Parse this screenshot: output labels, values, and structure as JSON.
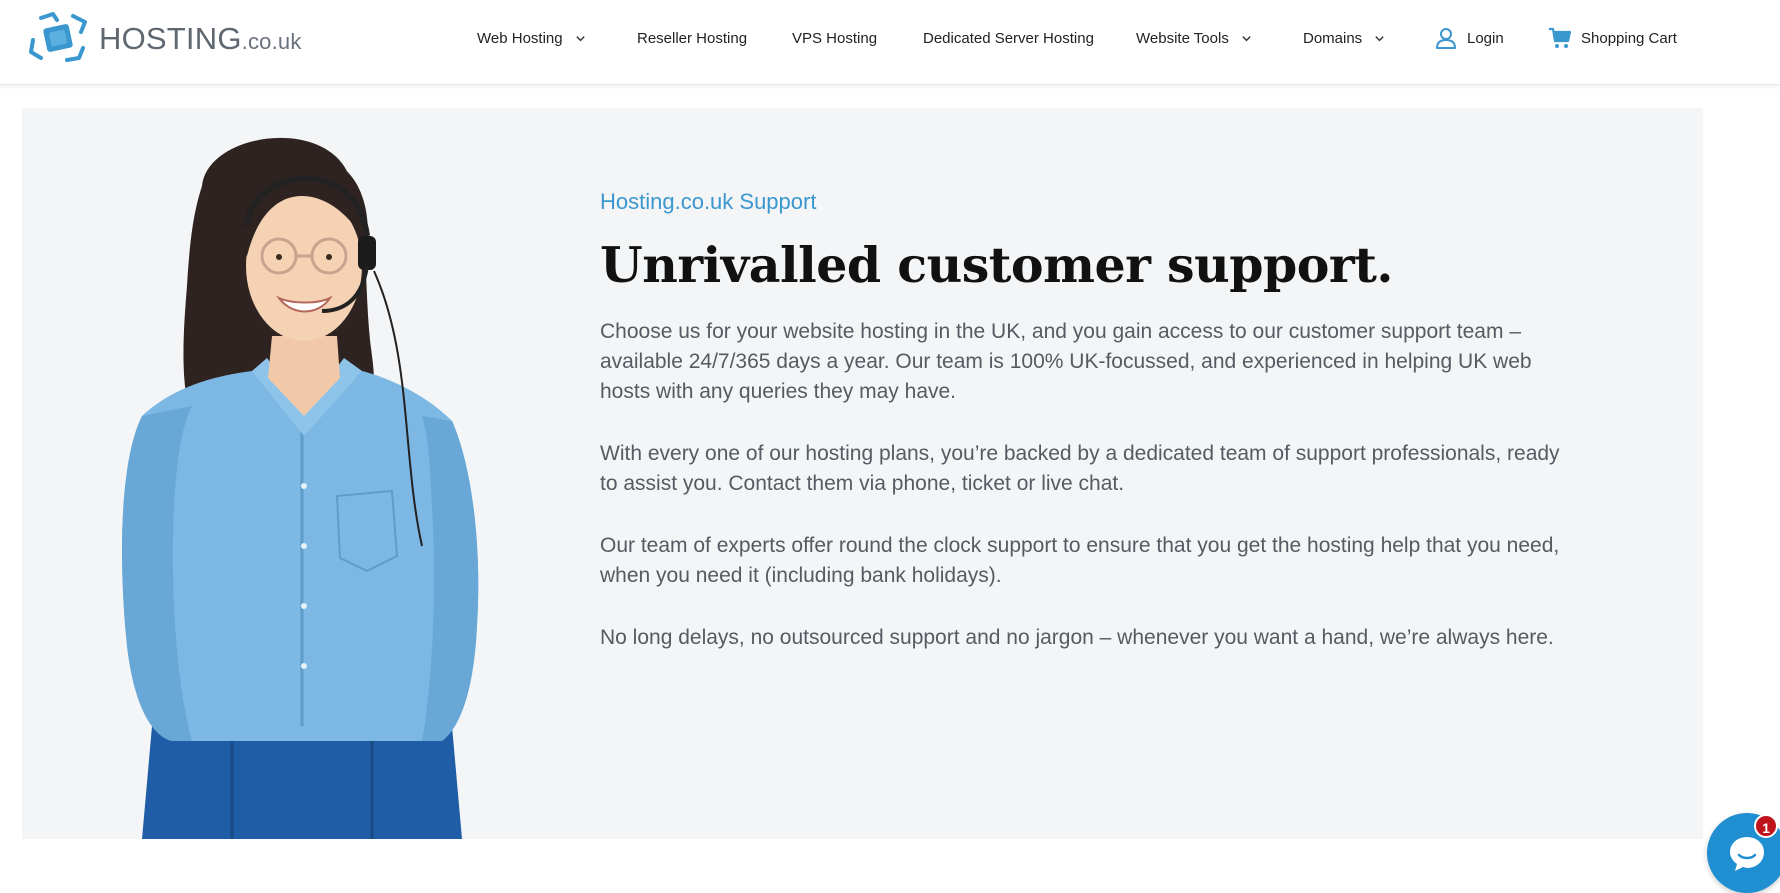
{
  "brand": {
    "name_main": "HOSTING",
    "name_suffix": ".co.uk",
    "accent_color": "#3a97cf",
    "logo_icon": "hosting-cube-logo"
  },
  "nav": {
    "items": [
      {
        "label": "Web Hosting",
        "has_dropdown": true
      },
      {
        "label": "Reseller Hosting",
        "has_dropdown": false
      },
      {
        "label": "VPS Hosting",
        "has_dropdown": false
      },
      {
        "label": "Dedicated Server Hosting",
        "has_dropdown": false
      },
      {
        "label": "Website Tools",
        "has_dropdown": true
      },
      {
        "label": "Domains",
        "has_dropdown": true
      }
    ],
    "login": {
      "label": "Login",
      "icon": "user-icon"
    },
    "cart": {
      "label": "Shopping Cart",
      "icon": "cart-icon"
    }
  },
  "hero": {
    "eyebrow": "Hosting.co.uk Support",
    "headline": "Unrivalled customer support.",
    "paragraphs": [
      "Choose us for your website hosting in the UK, and you gain access to our customer support team – available 24/7/365 days a year. Our team is 100% UK-focussed, and experienced in helping UK web hosts with any queries they may have.",
      "With every one of our hosting plans, you’re backed by a dedicated team of support professionals, ready to assist you. Contact them via phone, ticket or live chat.",
      "Our team of experts offer round the clock support to ensure that you get the hosting help that you need, when you need it (including bank holidays).",
      "No long delays, no outsourced support and no jargon – whenever you want a hand, we’re always here."
    ],
    "image": "support-agent-photo"
  },
  "chat": {
    "icon": "chat-bubble-icon",
    "badge_count": "1",
    "color": "#1f8fd1",
    "badge_color": "#c0141c"
  }
}
